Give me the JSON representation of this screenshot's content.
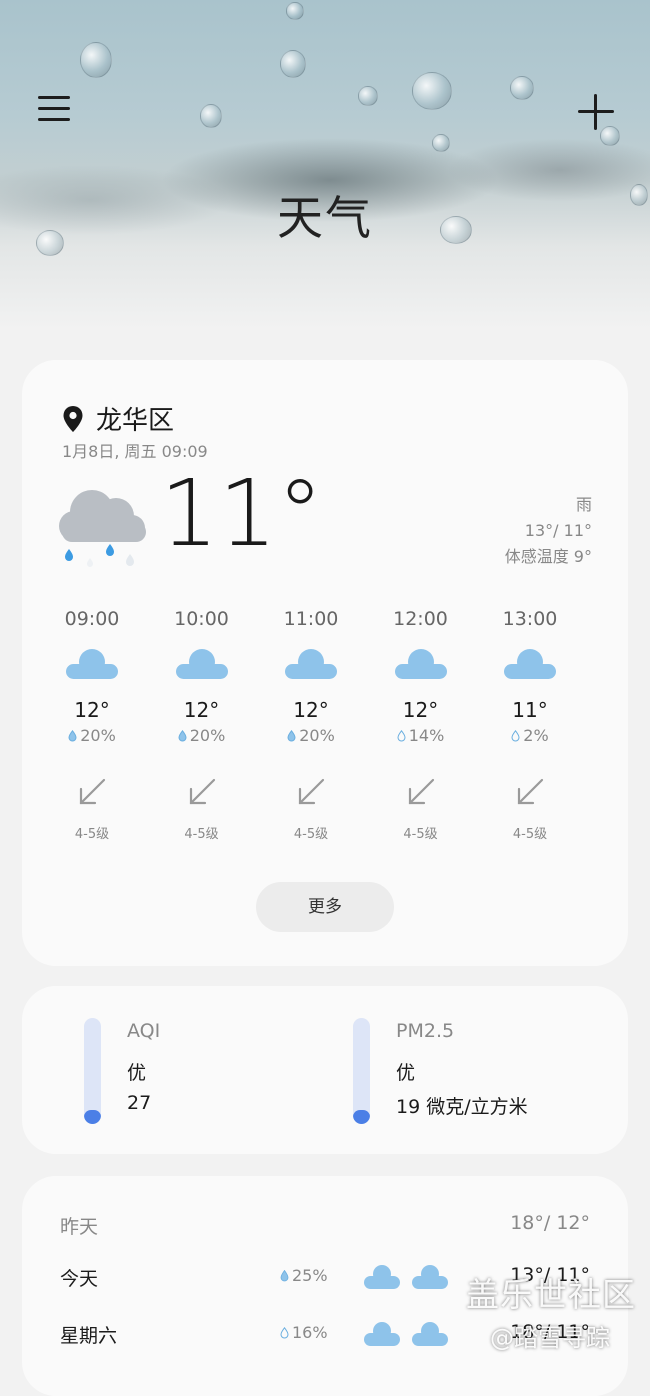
{
  "header": {
    "title": "天气",
    "menu_icon": "hamburger-menu-icon",
    "add_icon": "plus-icon"
  },
  "current": {
    "location": "龙华区",
    "datetime": "1月8日, 周五 09:09",
    "temperature": "11°",
    "condition": "雨",
    "high_low": "13°/ 11°",
    "feels_like": "体感温度 9°",
    "icon": "rain-cloud-icon"
  },
  "hourly": [
    {
      "time": "09:00",
      "temp": "12°",
      "pop": "20%",
      "wind": "4-5级"
    },
    {
      "time": "10:00",
      "temp": "12°",
      "pop": "20%",
      "wind": "4-5级"
    },
    {
      "time": "11:00",
      "temp": "12°",
      "pop": "20%",
      "wind": "4-5级"
    },
    {
      "time": "12:00",
      "temp": "12°",
      "pop": "14%",
      "wind": "4-5级"
    },
    {
      "time": "13:00",
      "temp": "11°",
      "pop": "2%",
      "wind": "4-5级"
    }
  ],
  "more_label": "更多",
  "air": {
    "aqi": {
      "title": "AQI",
      "level": "优",
      "value": "27",
      "fill_fraction": 0.12
    },
    "pm25": {
      "title": "PM2.5",
      "level": "优",
      "value": "19 微克/立方米",
      "fill_fraction": 0.12
    }
  },
  "forecast": [
    {
      "day": "昨天",
      "pop": "",
      "temp": "18°/ 12°"
    },
    {
      "day": "今天",
      "pop": "25%",
      "temp": "13°/ 11°"
    },
    {
      "day": "星期六",
      "pop": "16%",
      "temp": "18°/ 11°"
    }
  ],
  "watermark": {
    "line1": "盖乐世社区",
    "line2": "@踏雪寻踪"
  },
  "colors": {
    "cloud": "#8ec3ea",
    "gauge_fill": "#4b7fe6",
    "gauge_track": "#dde5f7",
    "card": "#fafafa",
    "background": "#f2f2f2"
  }
}
